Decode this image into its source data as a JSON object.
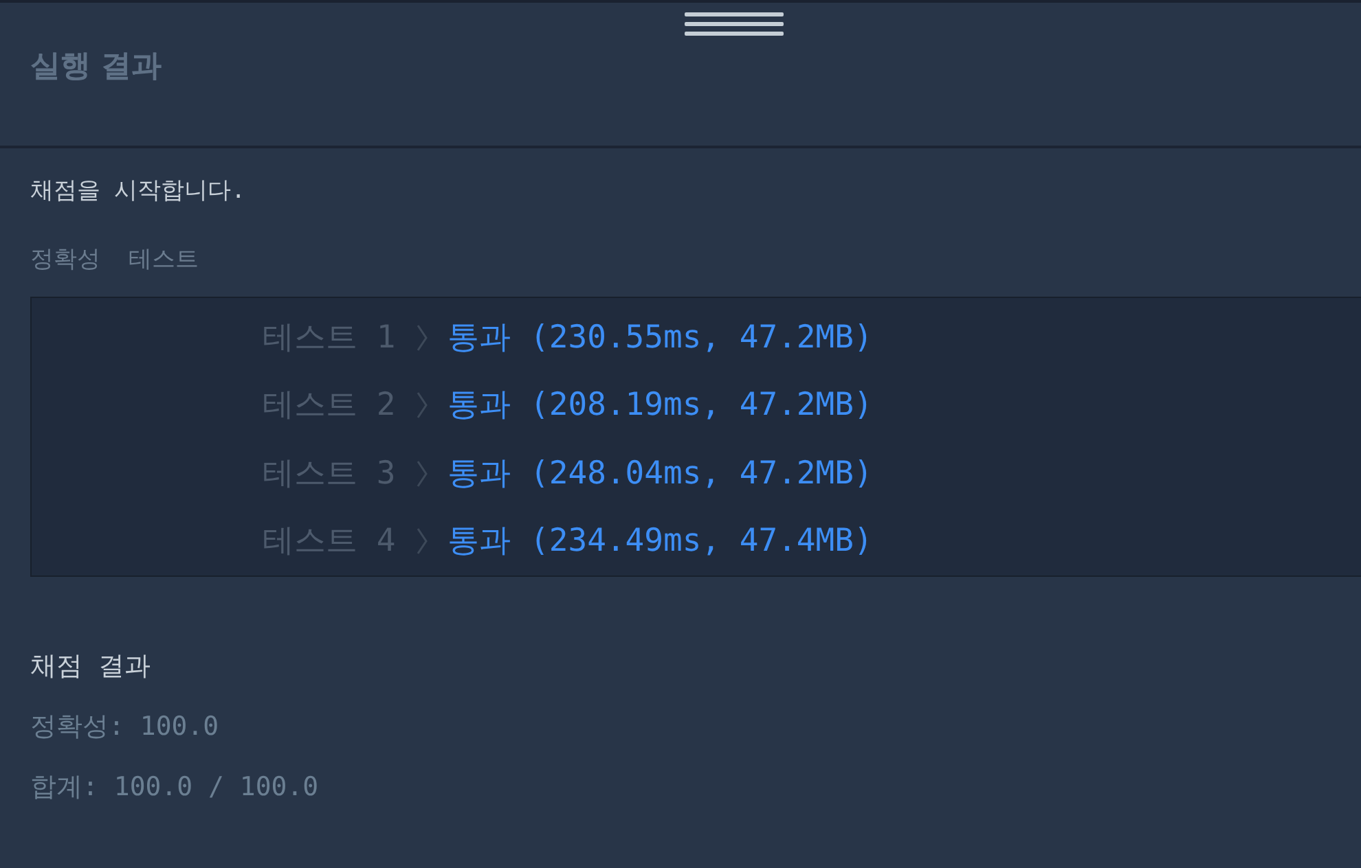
{
  "panel": {
    "title": "실행 결과"
  },
  "grading": {
    "message": "채점을 시작합니다.",
    "heading": "정확성  테스트",
    "tests": [
      {
        "label": "테스트 1",
        "result": "통과 (230.55ms, 47.2MB)",
        "passed": true
      },
      {
        "label": "테스트 2",
        "result": "통과 (208.19ms, 47.2MB)",
        "passed": true
      },
      {
        "label": "테스트 3",
        "result": "통과 (248.04ms, 47.2MB)",
        "passed": true
      },
      {
        "label": "테스트 4",
        "result": "통과 (234.49ms, 47.4MB)",
        "passed": true
      }
    ]
  },
  "summary": {
    "title": "채점 결과",
    "lines": [
      "정확성: 100.0",
      "합계: 100.0 / 100.0"
    ]
  }
}
